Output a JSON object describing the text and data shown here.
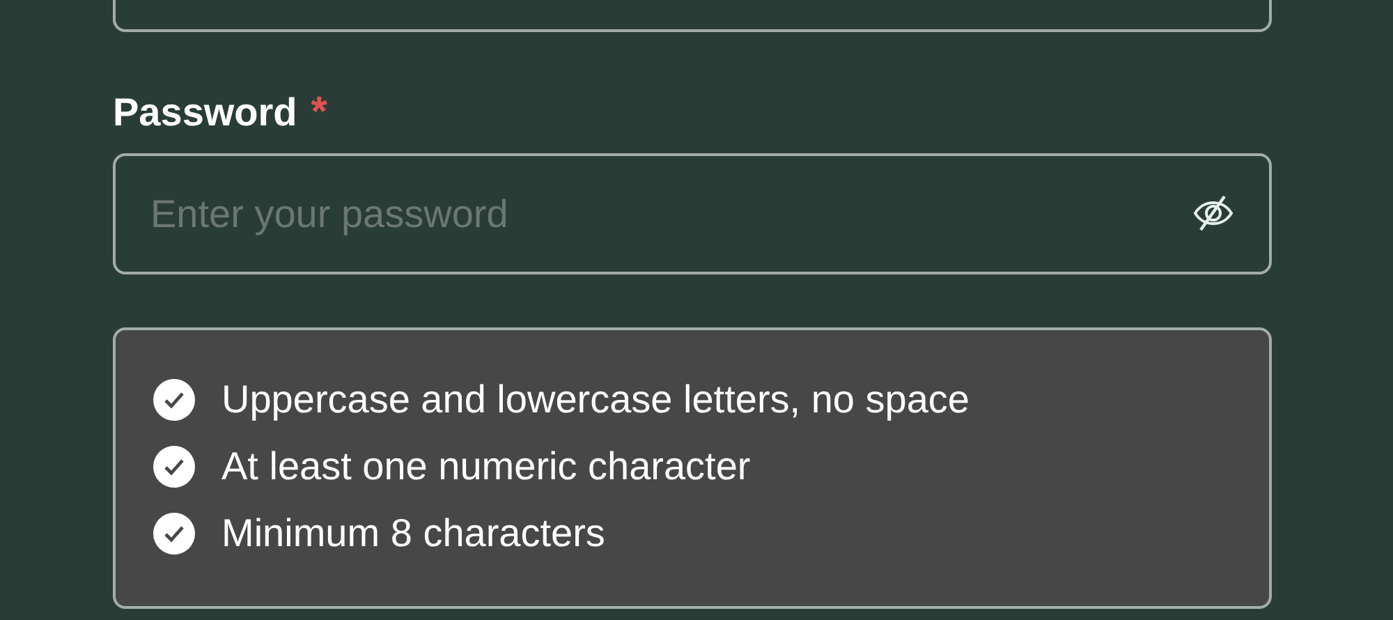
{
  "password": {
    "label": "Password",
    "required_mark": "*",
    "placeholder": "Enter your password",
    "visible": false
  },
  "requirements": [
    {
      "text": "Uppercase and lowercase letters, no space",
      "met": true
    },
    {
      "text": "At least one numeric character",
      "met": true
    },
    {
      "text": "Minimum 8 characters",
      "met": true
    }
  ]
}
